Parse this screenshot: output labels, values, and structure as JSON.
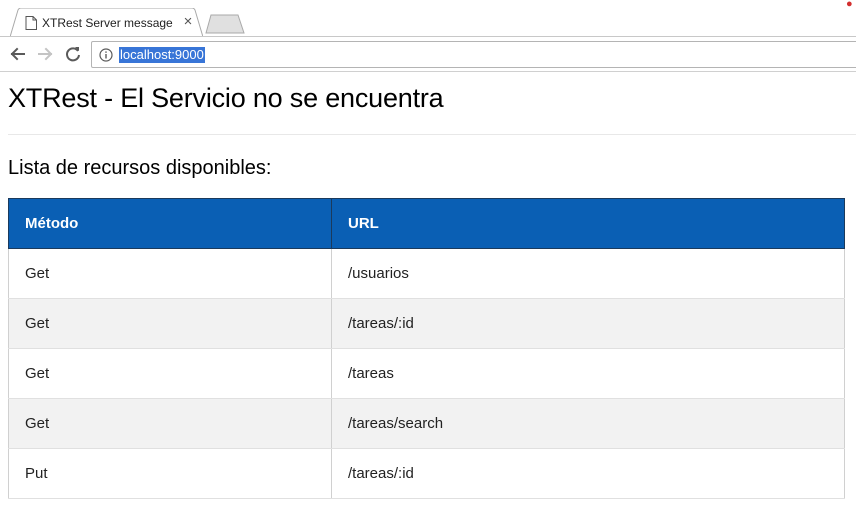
{
  "browser": {
    "tab": {
      "title": "XTRest Server message",
      "close_glyph": "×"
    },
    "address_bar": {
      "url": "localhost:9000"
    },
    "icons": [
      "document-icon",
      "close-icon",
      "new-tab-icon",
      "back-arrow-icon",
      "forward-arrow-icon",
      "reload-icon",
      "info-icon"
    ]
  },
  "page": {
    "title": "XTRest - El Servicio no se encuentra",
    "subtitle": "Lista de recursos disponibles:",
    "table": {
      "headers": {
        "method": "Método",
        "url": "URL"
      },
      "rows": [
        {
          "method": "Get",
          "url": "/usuarios"
        },
        {
          "method": "Get",
          "url": "/tareas/:id"
        },
        {
          "method": "Get",
          "url": "/tareas"
        },
        {
          "method": "Get",
          "url": "/tareas/search"
        },
        {
          "method": "Put",
          "url": "/tareas/:id"
        }
      ]
    }
  },
  "colors": {
    "table_header_bg": "#0a5fb4",
    "url_highlight": "#3875d7",
    "row_alt_bg": "#f2f2f2"
  }
}
